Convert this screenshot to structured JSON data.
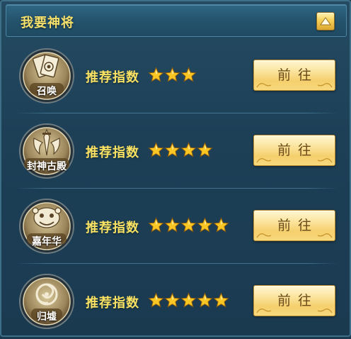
{
  "header": {
    "title": "我要神将"
  },
  "items": [
    {
      "name": "召唤",
      "icon": "summon-cards-icon",
      "label": "推荐指数",
      "rating": 3,
      "button": "前往"
    },
    {
      "name": "封神古殿",
      "icon": "ancient-temple-icon",
      "label": "推荐指数",
      "rating": 4,
      "button": "前往"
    },
    {
      "name": "嘉年华",
      "icon": "carnival-lion-icon",
      "label": "推荐指数",
      "rating": 5,
      "button": "前往"
    },
    {
      "name": "归墟",
      "icon": "vortex-icon",
      "label": "推荐指数",
      "rating": 5,
      "button": "前往"
    }
  ],
  "colors": {
    "title_gold": "#f4e06c",
    "star_gold": "#f9c623",
    "panel_blue": "#1d4057"
  }
}
